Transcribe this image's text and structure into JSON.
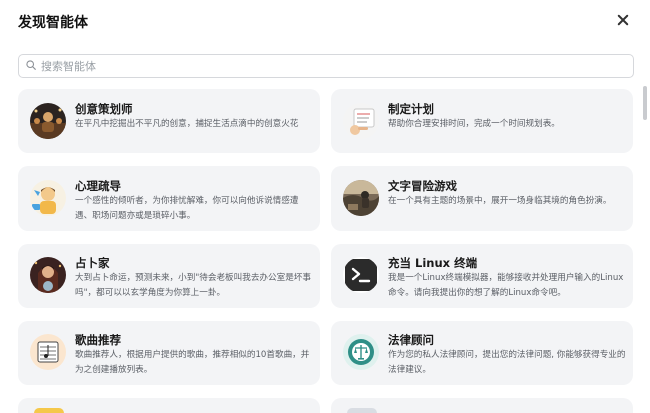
{
  "header": {
    "title": "发现智能体"
  },
  "search": {
    "placeholder": "搜索智能体"
  },
  "agents": [
    {
      "name": "创意策划师",
      "desc": "在平凡中挖掘出不平凡的创意，捕捉生活点滴中的创意火花",
      "icon": "creative-planner-avatar"
    },
    {
      "name": "制定计划",
      "desc": "帮助你合理安排时间，完成一个时间规划表。",
      "icon": "planner-avatar"
    },
    {
      "name": "心理疏导",
      "desc": "一个感性的倾听者，为你排忧解难，你可以向他诉说情感遭遇、职场问题亦或是琐碎小事。",
      "icon": "counselor-avatar"
    },
    {
      "name": "文字冒险游戏",
      "desc": "在一个具有主题的场景中，展开一场身临其境的角色扮演。",
      "icon": "adventure-game-avatar"
    },
    {
      "name": "占卜家",
      "desc": "大到占卜命运，预测未来，小到\"待会老板叫我去办公室是坏事吗\"，都可以以玄学角度为你算上一卦。",
      "icon": "fortune-teller-avatar"
    },
    {
      "name": "充当 Linux 终端",
      "desc": "我是一个Linux终端模拟器，能够接收并处理用户输入的Linux命令。请向我提出你的想了解的Linux命令吧。",
      "icon": "terminal-avatar"
    },
    {
      "name": "歌曲推荐",
      "desc": "歌曲推荐人，根据用户提供的歌曲，推荐相似的10首歌曲，并为之创建播放列表。",
      "icon": "music-avatar"
    },
    {
      "name": "法律顾问",
      "desc": "作为您的私人法律顾问，提出您的法律问题, 你能够获得专业的法律建议。",
      "icon": "legal-avatar"
    }
  ]
}
